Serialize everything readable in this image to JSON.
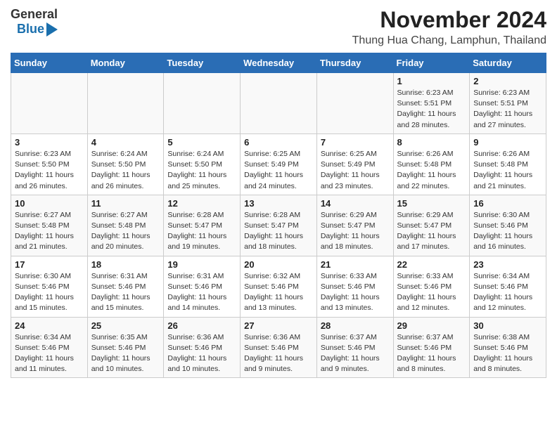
{
  "logo": {
    "general": "General",
    "blue": "Blue"
  },
  "header": {
    "month_year": "November 2024",
    "location": "Thung Hua Chang, Lamphun, Thailand"
  },
  "weekdays": [
    "Sunday",
    "Monday",
    "Tuesday",
    "Wednesday",
    "Thursday",
    "Friday",
    "Saturday"
  ],
  "weeks": [
    [
      {
        "day": "",
        "info": ""
      },
      {
        "day": "",
        "info": ""
      },
      {
        "day": "",
        "info": ""
      },
      {
        "day": "",
        "info": ""
      },
      {
        "day": "",
        "info": ""
      },
      {
        "day": "1",
        "info": "Sunrise: 6:23 AM\nSunset: 5:51 PM\nDaylight: 11 hours and 28 minutes."
      },
      {
        "day": "2",
        "info": "Sunrise: 6:23 AM\nSunset: 5:51 PM\nDaylight: 11 hours and 27 minutes."
      }
    ],
    [
      {
        "day": "3",
        "info": "Sunrise: 6:23 AM\nSunset: 5:50 PM\nDaylight: 11 hours and 26 minutes."
      },
      {
        "day": "4",
        "info": "Sunrise: 6:24 AM\nSunset: 5:50 PM\nDaylight: 11 hours and 26 minutes."
      },
      {
        "day": "5",
        "info": "Sunrise: 6:24 AM\nSunset: 5:50 PM\nDaylight: 11 hours and 25 minutes."
      },
      {
        "day": "6",
        "info": "Sunrise: 6:25 AM\nSunset: 5:49 PM\nDaylight: 11 hours and 24 minutes."
      },
      {
        "day": "7",
        "info": "Sunrise: 6:25 AM\nSunset: 5:49 PM\nDaylight: 11 hours and 23 minutes."
      },
      {
        "day": "8",
        "info": "Sunrise: 6:26 AM\nSunset: 5:48 PM\nDaylight: 11 hours and 22 minutes."
      },
      {
        "day": "9",
        "info": "Sunrise: 6:26 AM\nSunset: 5:48 PM\nDaylight: 11 hours and 21 minutes."
      }
    ],
    [
      {
        "day": "10",
        "info": "Sunrise: 6:27 AM\nSunset: 5:48 PM\nDaylight: 11 hours and 21 minutes."
      },
      {
        "day": "11",
        "info": "Sunrise: 6:27 AM\nSunset: 5:48 PM\nDaylight: 11 hours and 20 minutes."
      },
      {
        "day": "12",
        "info": "Sunrise: 6:28 AM\nSunset: 5:47 PM\nDaylight: 11 hours and 19 minutes."
      },
      {
        "day": "13",
        "info": "Sunrise: 6:28 AM\nSunset: 5:47 PM\nDaylight: 11 hours and 18 minutes."
      },
      {
        "day": "14",
        "info": "Sunrise: 6:29 AM\nSunset: 5:47 PM\nDaylight: 11 hours and 18 minutes."
      },
      {
        "day": "15",
        "info": "Sunrise: 6:29 AM\nSunset: 5:47 PM\nDaylight: 11 hours and 17 minutes."
      },
      {
        "day": "16",
        "info": "Sunrise: 6:30 AM\nSunset: 5:46 PM\nDaylight: 11 hours and 16 minutes."
      }
    ],
    [
      {
        "day": "17",
        "info": "Sunrise: 6:30 AM\nSunset: 5:46 PM\nDaylight: 11 hours and 15 minutes."
      },
      {
        "day": "18",
        "info": "Sunrise: 6:31 AM\nSunset: 5:46 PM\nDaylight: 11 hours and 15 minutes."
      },
      {
        "day": "19",
        "info": "Sunrise: 6:31 AM\nSunset: 5:46 PM\nDaylight: 11 hours and 14 minutes."
      },
      {
        "day": "20",
        "info": "Sunrise: 6:32 AM\nSunset: 5:46 PM\nDaylight: 11 hours and 13 minutes."
      },
      {
        "day": "21",
        "info": "Sunrise: 6:33 AM\nSunset: 5:46 PM\nDaylight: 11 hours and 13 minutes."
      },
      {
        "day": "22",
        "info": "Sunrise: 6:33 AM\nSunset: 5:46 PM\nDaylight: 11 hours and 12 minutes."
      },
      {
        "day": "23",
        "info": "Sunrise: 6:34 AM\nSunset: 5:46 PM\nDaylight: 11 hours and 12 minutes."
      }
    ],
    [
      {
        "day": "24",
        "info": "Sunrise: 6:34 AM\nSunset: 5:46 PM\nDaylight: 11 hours and 11 minutes."
      },
      {
        "day": "25",
        "info": "Sunrise: 6:35 AM\nSunset: 5:46 PM\nDaylight: 11 hours and 10 minutes."
      },
      {
        "day": "26",
        "info": "Sunrise: 6:36 AM\nSunset: 5:46 PM\nDaylight: 11 hours and 10 minutes."
      },
      {
        "day": "27",
        "info": "Sunrise: 6:36 AM\nSunset: 5:46 PM\nDaylight: 11 hours and 9 minutes."
      },
      {
        "day": "28",
        "info": "Sunrise: 6:37 AM\nSunset: 5:46 PM\nDaylight: 11 hours and 9 minutes."
      },
      {
        "day": "29",
        "info": "Sunrise: 6:37 AM\nSunset: 5:46 PM\nDaylight: 11 hours and 8 minutes."
      },
      {
        "day": "30",
        "info": "Sunrise: 6:38 AM\nSunset: 5:46 PM\nDaylight: 11 hours and 8 minutes."
      }
    ]
  ]
}
